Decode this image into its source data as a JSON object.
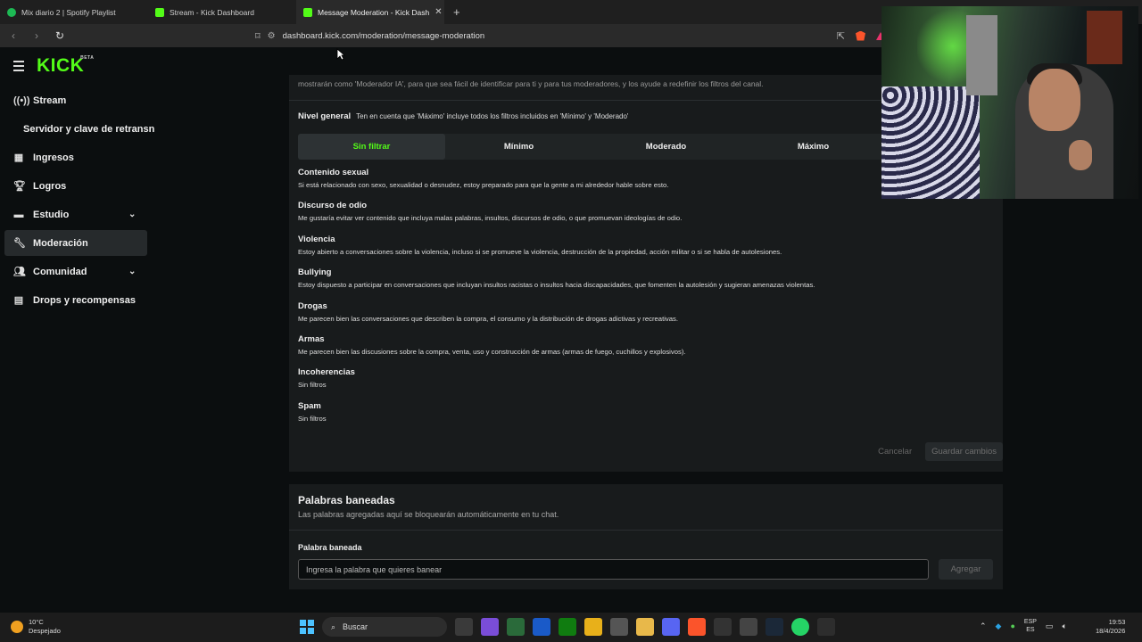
{
  "browser": {
    "tabs": [
      {
        "title": "Mix diario 2 | Spotify Playlist",
        "favicon": "spotify-icon"
      },
      {
        "title": "Stream - Kick Dashboard",
        "favicon": "kick-icon"
      },
      {
        "title": "Message Moderation - Kick Dash",
        "favicon": "kick-icon",
        "active": true
      }
    ],
    "url": "dashboard.kick.com/moderation/message-moderation"
  },
  "sidebar": {
    "logo": "KICK",
    "logo_badge": "BETA",
    "items": [
      {
        "label": "Stream",
        "icon": "broadcast-icon"
      },
      {
        "label": "Servidor y clave de retransn",
        "icon": ""
      },
      {
        "label": "Ingresos",
        "icon": "chart-icon"
      },
      {
        "label": "Logros",
        "icon": "trophy-icon"
      },
      {
        "label": "Estudio",
        "icon": "studio-icon",
        "expandable": true
      },
      {
        "label": "Moderación",
        "icon": "wrench-icon",
        "active": true
      },
      {
        "label": "Comunidad",
        "icon": "users-icon",
        "expandable": true
      },
      {
        "label": "Drops y recompensas",
        "icon": "gift-icon"
      }
    ]
  },
  "moderation": {
    "intro_cut": "mostrarán como 'Moderador IA', para que sea fácil de identificar para ti y para tus moderadores, y los ayude a redefinir los filtros del canal.",
    "level_label": "Nivel general",
    "level_hint": "Ten en cuenta que 'Máximo' incluye todos los filtros incluidos en 'Mínimo' y 'Moderado'",
    "levels": [
      "Sin filtrar",
      "Mínimo",
      "Moderado",
      "Máximo"
    ],
    "selected_level": "Sin filtrar",
    "categories": [
      {
        "title": "Contenido sexual",
        "desc": "Si está relacionado con sexo, sexualidad o desnudez, estoy preparado para que la gente a mi alrededor hable sobre esto."
      },
      {
        "title": "Discurso de odio",
        "desc": "Me gustaría evitar ver contenido que incluya malas palabras, insultos, discursos de odio, o que promuevan ideologías de odio."
      },
      {
        "title": "Violencia",
        "desc": "Estoy abierto a conversaciones sobre la violencia, incluso si se promueve la violencia, destrucción de la propiedad, acción militar o si se habla de autolesiones."
      },
      {
        "title": "Bullying",
        "desc": "Estoy dispuesto a participar en conversaciones que incluyan insultos racistas o insultos hacia discapacidades, que fomenten la autolesión y sugieran amenazas violentas."
      },
      {
        "title": "Drogas",
        "desc": "Me parecen bien las conversaciones que describen la compra, el consumo y la distribución de drogas adictivas y recreativas."
      },
      {
        "title": "Armas",
        "desc": "Me parecen bien las discusiones sobre la compra, venta, uso y construcción de armas (armas de fuego, cuchillos y explosivos)."
      },
      {
        "title": "Incoherencias",
        "desc": "Sin filtros"
      },
      {
        "title": "Spam",
        "desc": "Sin filtros"
      }
    ],
    "cancel_label": "Cancelar",
    "save_label": "Guardar cambios"
  },
  "banned_words": {
    "title": "Palabras baneadas",
    "subtitle": "Las palabras agregadas aquí se bloquearán automáticamente en tu chat.",
    "field_label": "Palabra baneada",
    "placeholder": "Ingresa la palabra que quieres banear",
    "add_label": "Agregar"
  },
  "taskbar": {
    "weather_temp": "10°C",
    "weather_desc": "Despejado",
    "search_label": "Buscar",
    "lang_1": "ESP",
    "lang_2": "ES",
    "time": "19:53",
    "date": "18/4/2026"
  },
  "colors": {
    "accent": "#53fc18",
    "background": "#0b0e0f",
    "card": "#181b1c"
  }
}
